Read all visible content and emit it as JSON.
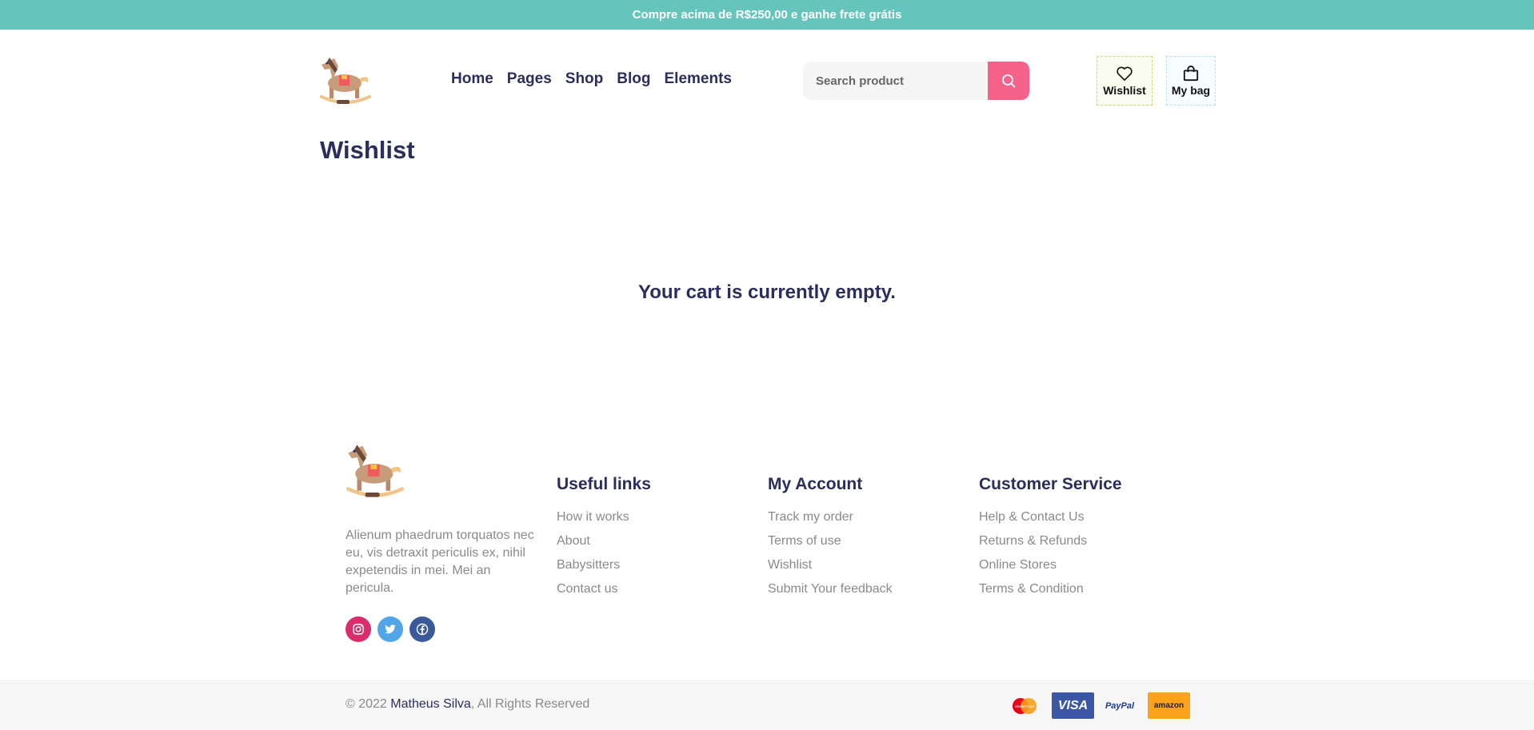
{
  "promo": {
    "text": "Compre acima de R$250,00 e ganhe frete grátis"
  },
  "header": {
    "logo_icon": "rocking-horse-icon",
    "nav": [
      {
        "label": "Home",
        "active": true
      },
      {
        "label": "Pages"
      },
      {
        "label": "Shop"
      },
      {
        "label": "Blog"
      },
      {
        "label": "Elements"
      }
    ],
    "search": {
      "placeholder": "Search product",
      "icon": "search-icon"
    },
    "wishlist_label": "Wishlist",
    "bag_label": "My bag"
  },
  "main": {
    "title": "Wishlist",
    "empty_message": "Your cart is currently empty."
  },
  "footer": {
    "description": "Alienum phaedrum torquatos nec eu, vis detraxit periculis ex, nihil expetendis in mei. Mei an pericula.",
    "social": [
      "instagram-icon",
      "twitter-icon",
      "facebook-icon"
    ],
    "columns": [
      {
        "title": "Useful links",
        "links": [
          "How it works",
          "About",
          "Babysitters",
          "Contact us"
        ]
      },
      {
        "title": "My Account",
        "links": [
          "Track my order",
          "Terms of use",
          "Wishlist",
          "Submit Your feedback"
        ]
      },
      {
        "title": "Customer Service",
        "links": [
          "Help & Contact Us",
          "Returns & Refunds",
          "Online Stores",
          "Terms & Condition"
        ]
      }
    ],
    "copyright_prefix": "© 2022 ",
    "author": "Matheus Silva",
    "copyright_suffix": ", All Rights Reserved",
    "payments": [
      "MasterCard",
      "VISA",
      "PayPal",
      "amazon"
    ]
  },
  "colors": {
    "promo_bg": "#65c5bd",
    "heading": "#2b2d5c",
    "search_button": "#f4628a",
    "instagram": "#d92e6a",
    "twitter": "#52a5e6",
    "facebook": "#3b5a99"
  }
}
